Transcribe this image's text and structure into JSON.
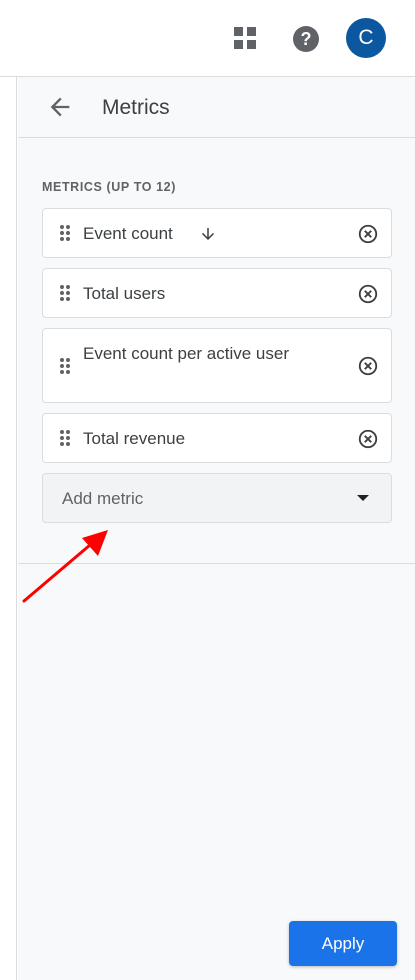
{
  "topbar": {
    "apps_icon": "apps-grid-icon",
    "help_icon": "help-icon",
    "help_glyph": "?",
    "avatar_letter": "C"
  },
  "panel": {
    "title": "Metrics",
    "back_icon": "arrow-back-icon",
    "section_label": "METRICS (UP TO 12)",
    "metrics": [
      {
        "label": "Event count",
        "sort_icon": "arrow-downward-icon"
      },
      {
        "label": "Total users"
      },
      {
        "label": "Event count per active user"
      },
      {
        "label": "Total revenue"
      }
    ],
    "add_metric_placeholder": "Add metric",
    "apply_label": "Apply"
  },
  "colors": {
    "primary": "#1a73e8",
    "avatar": "#0b57a0",
    "panel_bg": "#f8f9fa",
    "annotation": "#ff0000"
  }
}
